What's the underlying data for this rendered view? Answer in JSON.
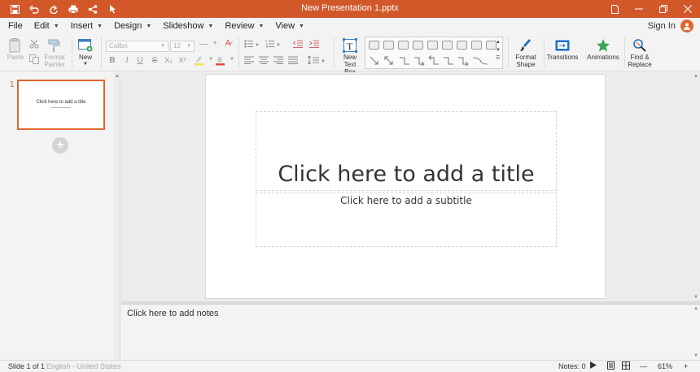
{
  "window": {
    "title": "New Presentation 1.pptx"
  },
  "quick_access": [
    "save-icon",
    "undo-icon",
    "redo-icon",
    "print-icon",
    "share-icon",
    "pointer-icon"
  ],
  "menu": {
    "items": [
      {
        "label": "File",
        "has_caret": false
      },
      {
        "label": "Edit",
        "has_caret": true
      },
      {
        "label": "Insert",
        "has_caret": true
      },
      {
        "label": "Design",
        "has_caret": true
      },
      {
        "label": "Slideshow",
        "has_caret": true
      },
      {
        "label": "Review",
        "has_caret": true
      },
      {
        "label": "View",
        "has_caret": true
      }
    ],
    "sign_in": "Sign In"
  },
  "ribbon": {
    "paste": "Paste",
    "format_painter_1": "Format",
    "format_painter_2": "Painter",
    "new": "New",
    "font_name": "Calibri",
    "font_size": "12",
    "new_text_box_1": "New",
    "new_text_box_2": "Text Box",
    "format_shape_1": "Format",
    "format_shape_2": "Shape",
    "transitions": "Transitions",
    "animations": "Animations",
    "find_replace_1": "Find &",
    "find_replace_2": "Replace"
  },
  "slides": {
    "current_number": "1",
    "thumb_title": "Click here to add a title"
  },
  "slide": {
    "title_placeholder": "Click here to add a title",
    "subtitle_placeholder": "Click here to add a subtitle"
  },
  "notes": {
    "placeholder": "Click here to add notes"
  },
  "status": {
    "slide_info": "Slide 1 of 1",
    "language": "English - United States",
    "notes_count": "Notes: 0",
    "zoom": "61%"
  },
  "colors": {
    "accent": "#d2582a",
    "accent_light": "#e0662e"
  }
}
